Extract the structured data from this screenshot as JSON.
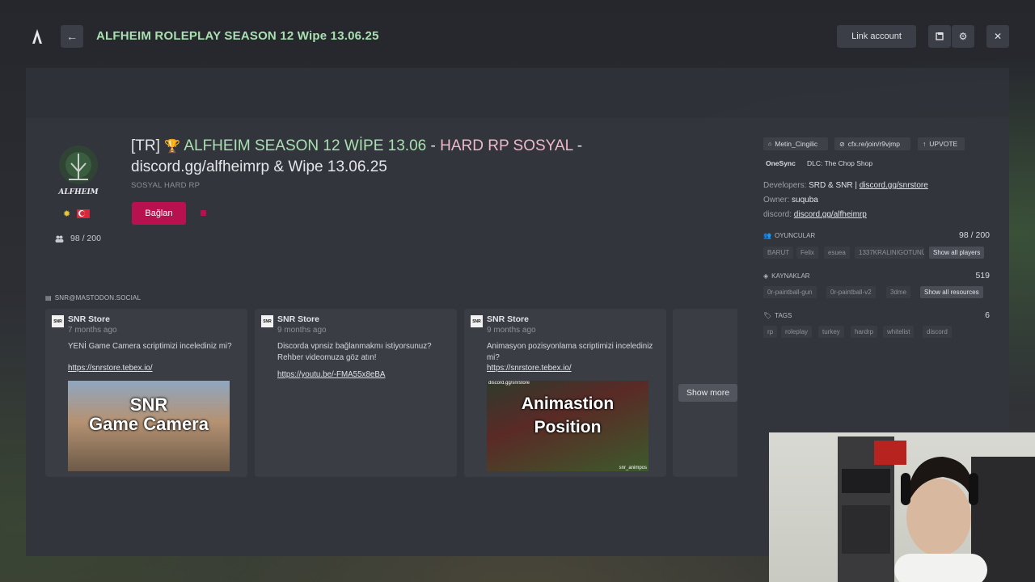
{
  "header": {
    "title": "ALFHEIM ROLEPLAY SEASON 12 Wipe 13.06.25",
    "link_account": "Link account",
    "back_icon": "arrow-left-icon",
    "close_icon": "close-icon"
  },
  "server": {
    "name_prefix": "[TR] ",
    "name_trophy": "🏆",
    "name_green": " ALFHEIM SEASON 12 WİPE 13.06",
    "name_dash1": " - ",
    "name_pink": "HARD RP SOSYAL",
    "name_dash2": " -",
    "name_line2": "discord.gg/alfheimrp & Wipe 13.06.25",
    "subtitle": "SOSYAL HARD RP",
    "connect_label": "Bağlan",
    "players": "98 / 200",
    "logo_text": "ALFHEIM"
  },
  "feed": {
    "label": "SNR@MASTODON.SOCIAL",
    "show_more": "Show more",
    "cards": [
      {
        "avatar": "SNR",
        "author": "SNR Store",
        "time": "7 months ago",
        "text": "YENİ Game Camera scriptimizi incelediniz mi?",
        "link": "https://snrstore.tebex.io/",
        "media_line1": "SNR",
        "media_line2": "Game Camera"
      },
      {
        "avatar": "SNR",
        "author": "SNR Store",
        "time": "9 months ago",
        "text": "Discorda vpnsiz bağlanmakmı istiyorsunuz? Rehber videomuza göz atın!",
        "link": "https://youtu.be/-FMA55x8eBA"
      },
      {
        "avatar": "SNR",
        "author": "SNR Store",
        "time": "9 months ago",
        "text": "Animasyon pozisyonlama scriptimizi incelediniz mi?",
        "link": "https://snrstore.tebex.io/",
        "media_tag": "discord.gg/snrstore",
        "media_line1": "Animastion",
        "media_line2": "Position",
        "media_credit": "snr_animpos"
      }
    ]
  },
  "sidebar": {
    "chips": [
      "Metin_Cingilic",
      "cfx.re/join/r9vjmp",
      "UPVOTE"
    ],
    "onesync": "OneSync",
    "dlc": "DLC: The Chop Shop",
    "developers_label": "Developers:",
    "developers_value": "SRD & SNR | ",
    "developers_link": "discord.gg/snrstore",
    "owner_label": "Owner:",
    "owner_value": "suquba",
    "discord_label": "discord:",
    "discord_value": "discord.gg/alfheimrp",
    "players_head": "OYUNCULAR",
    "players_count": "98 / 200",
    "players_list": [
      "BARUT",
      "Felix",
      "esuea",
      "1337KRALINIGOTUNÜ"
    ],
    "players_button": "Show all players",
    "resources_head": "KAYNAKLAR",
    "resources_count": "519",
    "resources_list": [
      "0r-paintball-gun",
      "0r-paintball-v2",
      "3dme"
    ],
    "resources_button": "Show all resources",
    "tags_head": "TAGS",
    "tags_count": "6",
    "tags_list": [
      "rp",
      "roleplay",
      "turkey",
      "hardrp",
      "whitelist",
      "discord"
    ]
  }
}
